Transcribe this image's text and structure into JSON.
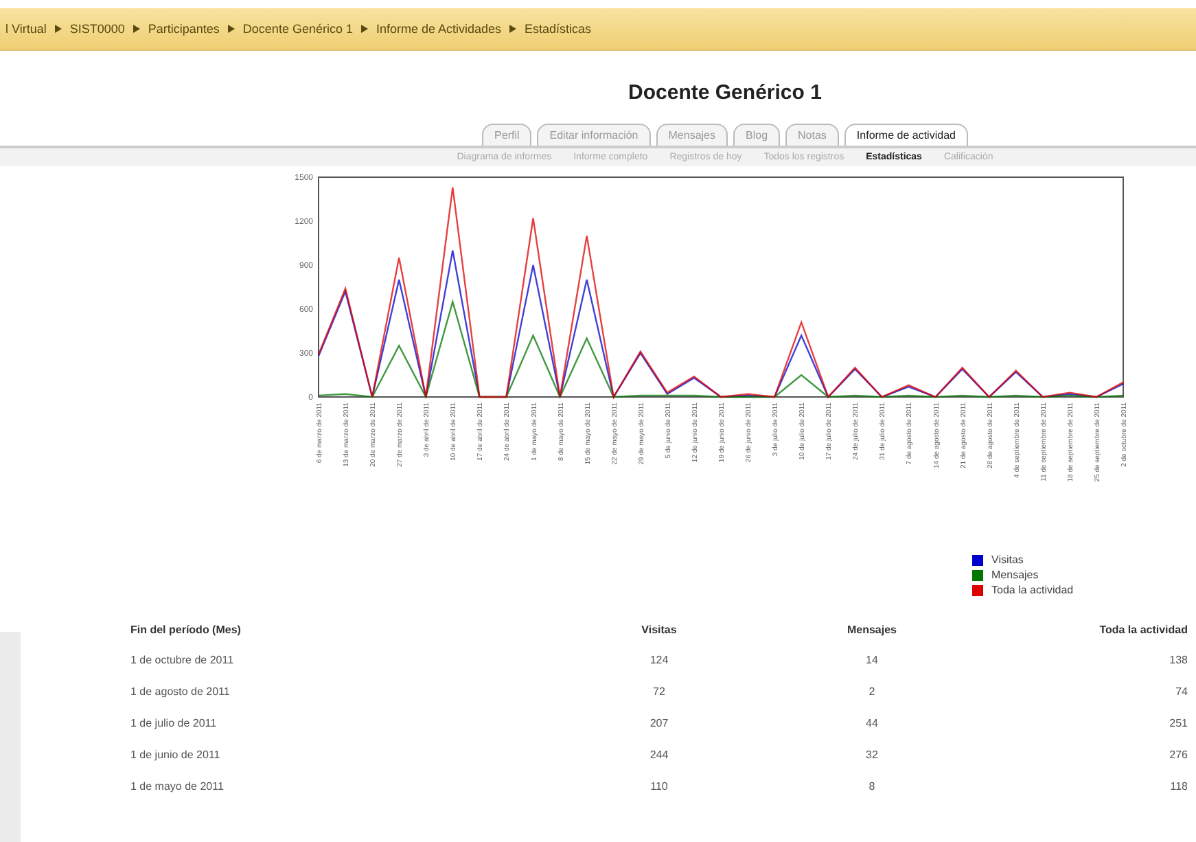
{
  "breadcrumb": [
    "l Virtual",
    "SIST0000",
    "Participantes",
    "Docente Genérico 1",
    "Informe de Actividades",
    "Estadísticas"
  ],
  "title": "Docente Genérico 1",
  "tabs": [
    {
      "label": "Perfil",
      "selected": false
    },
    {
      "label": "Editar información",
      "selected": false
    },
    {
      "label": "Mensajes",
      "selected": false
    },
    {
      "label": "Blog",
      "selected": false
    },
    {
      "label": "Notas",
      "selected": false
    },
    {
      "label": "Informe de actividad",
      "selected": true
    }
  ],
  "subtabs": [
    {
      "label": "Diagrama de informes",
      "selected": false
    },
    {
      "label": "Informe completo",
      "selected": false
    },
    {
      "label": "Registros de hoy",
      "selected": false
    },
    {
      "label": "Todos los registros",
      "selected": false
    },
    {
      "label": "Estadísticas",
      "selected": true
    },
    {
      "label": "Calificación",
      "selected": false
    }
  ],
  "chart": {
    "chart_data": {
      "type": "line",
      "ylim": [
        0,
        1500
      ],
      "yticks": [
        0,
        300,
        600,
        900,
        1200,
        1500
      ],
      "categories": [
        "6 de marzo de 2011",
        "13 de marzo de 2011",
        "20 de marzo de 2011",
        "27 de marzo de 2011",
        "3 de abril de 2011",
        "10 de abril de 2011",
        "17 de abril de 2011",
        "24 de abril de 2011",
        "1 de mayo de 2011",
        "8 de mayo de 2011",
        "15 de mayo de 2011",
        "22 de mayo de 2011",
        "29 de mayo de 2011",
        "5 de junio de 2011",
        "12 de junio de 2011",
        "19 de junio de 2011",
        "26 de junio de 2011",
        "3 de julio de 2011",
        "10 de julio de 2011",
        "17 de julio de 2011",
        "24 de julio de 2011",
        "31 de julio de 2011",
        "7 de agosto de 2011",
        "14 de agosto de 2011",
        "21 de agosto de 2011",
        "28 de agosto de 2011",
        "4 de septiembre de 2011",
        "11 de septiembre de 2011",
        "18 de septiembre de 2011",
        "25 de septiembre de 2011",
        "2 de octubre de 2011"
      ],
      "series": [
        {
          "name": "Visitas",
          "color": "#0000cc",
          "values": [
            280,
            720,
            0,
            800,
            0,
            1000,
            0,
            0,
            900,
            0,
            800,
            0,
            300,
            20,
            130,
            0,
            10,
            0,
            420,
            0,
            190,
            0,
            70,
            0,
            190,
            0,
            170,
            0,
            20,
            0,
            90
          ]
        },
        {
          "name": "Mensajes",
          "color": "#007700",
          "values": [
            10,
            20,
            0,
            350,
            0,
            650,
            0,
            0,
            420,
            0,
            400,
            0,
            10,
            10,
            10,
            0,
            0,
            0,
            150,
            0,
            10,
            0,
            10,
            0,
            10,
            0,
            10,
            0,
            10,
            0,
            10
          ]
        },
        {
          "name": "Toda la actividad",
          "color": "#dd0000",
          "values": [
            290,
            740,
            0,
            950,
            0,
            1430,
            0,
            0,
            1220,
            0,
            1100,
            0,
            310,
            30,
            140,
            0,
            20,
            0,
            510,
            0,
            200,
            0,
            80,
            0,
            200,
            0,
            180,
            0,
            30,
            0,
            100
          ]
        }
      ]
    }
  },
  "table": {
    "columns": [
      "Fin del período (Mes)",
      "Visitas",
      "Mensajes",
      "Toda la actividad"
    ],
    "rows": [
      [
        "1 de octubre de 2011",
        "124",
        "14",
        "138"
      ],
      [
        "1 de agosto de 2011",
        "72",
        "2",
        "74"
      ],
      [
        "1 de julio de 2011",
        "207",
        "44",
        "251"
      ],
      [
        "1 de junio de 2011",
        "244",
        "32",
        "276"
      ],
      [
        "1 de mayo de 2011",
        "110",
        "8",
        "118"
      ]
    ]
  }
}
